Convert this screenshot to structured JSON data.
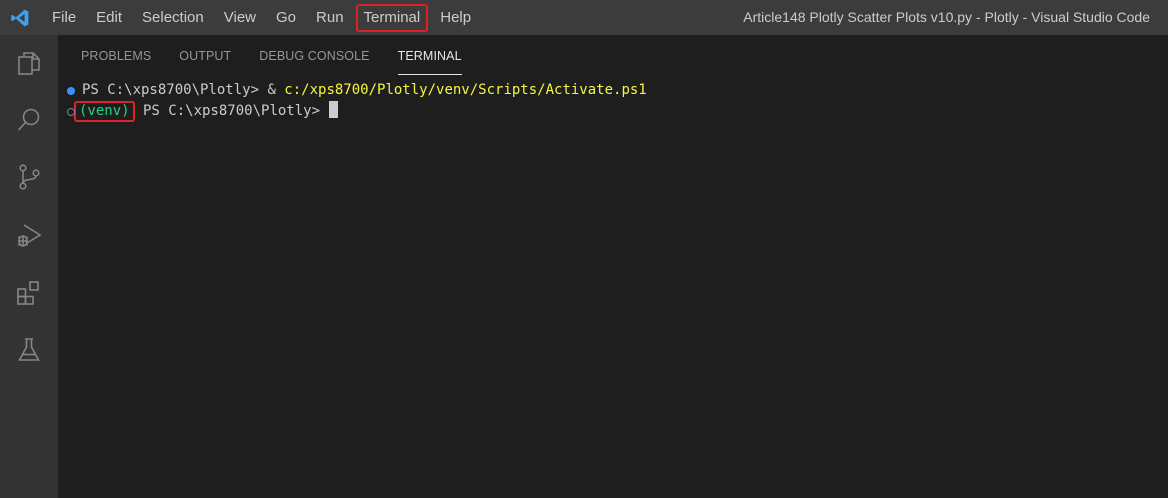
{
  "menu": {
    "items": [
      "File",
      "Edit",
      "Selection",
      "View",
      "Go",
      "Run",
      "Terminal",
      "Help"
    ]
  },
  "window_title": "Article148 Plotly Scatter Plots v10.py - Plotly - Visual Studio Code",
  "activity_bar": {
    "icons": [
      "files-icon",
      "search-icon",
      "source-control-icon",
      "run-debug-icon",
      "extensions-icon",
      "testing-icon"
    ]
  },
  "panel": {
    "tabs": [
      "PROBLEMS",
      "OUTPUT",
      "DEBUG CONSOLE",
      "TERMINAL"
    ],
    "active_tab": "TERMINAL"
  },
  "terminal": {
    "line1": {
      "prompt": "PS C:\\xps8700\\Plotly> ",
      "operator": "& ",
      "command": "c:/xps8700/Plotly/venv/Scripts/Activate.ps1"
    },
    "line2": {
      "venv": "(venv)",
      "prompt": " PS C:\\xps8700\\Plotly> "
    }
  },
  "colors": {
    "highlight_box": "#e0202a",
    "venv_text": "#23d18b",
    "command_path": "#f5f543",
    "success_decoration": "#3794ff"
  }
}
